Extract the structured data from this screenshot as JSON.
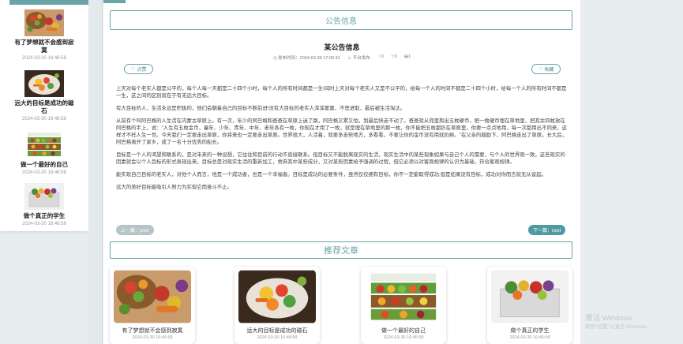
{
  "sidebar": {
    "items": [
      {
        "title": "有了梦想就不会感到寂寞",
        "time": "2024-03-30 16:46:58",
        "icon": "vegetable-basket-image"
      },
      {
        "title": "远大的目标是成功的磁石",
        "time": "2024-03-30 16:46:58",
        "icon": "vegetable-bowl-image"
      },
      {
        "title": "做一个最好的自己",
        "time": "2024-03-30 16:46:58",
        "icon": "produce-market-image"
      },
      {
        "title": "做个真正的学生",
        "time": "2024-03-30 16:46:58",
        "icon": "fruit-box-image"
      }
    ]
  },
  "notice": {
    "section_title": "公告信息",
    "title": "某公告信息",
    "meta": {
      "publish_time": "发布时间：2024-03-30 17:00:31",
      "publisher": "平台发布",
      "likes": "0",
      "favorites": "0",
      "views": "1"
    },
    "like_label": "点赞",
    "collect_label": "收藏",
    "paragraphs": [
      "上天对每个老实人都是公平的，每个人每一天都是二十四个小时，每个人的所有时间都是一生!间时上天对每个老实人又是不公平的，给每一个人的时间不都是二十四个小时，给每一个人的所有时间不都是一生，这之间的区别就在于有无远大目标。",
      "有大目标的人，生活永远是积极的，他们会朝着自己的目标不断前进!没有大目标的老实人浑浑噩噩，不思进取，最后被生活淘汰。",
      "从前有个叫阿巴格的人生活在内蒙古草原上。有一次，年少的阿巴格和爸爸在草原上迷了路，阿巴格又累又怕，到最后快走不动了。爸爸就从兜里掏出五枚硬币，把一枚硬币埋在草地里，把其余四枚放在阿巴格的手上，说：\"人生有五枚金币，童年、少年、青年、中年、老年各有一枚，你现在才用了一枚，就是埋在草地里的那一枚，你不能把五枚都扔在草原里，你要一点点地用，每一次都用出不同来，这样才不枉人生一世。今天我们一定要走出草原，你将来也一定要走出草原。世界很大，人活着，就要多走些地方，多看看，不要让你的金币没有用就扔掉。\"在父亲的鼓励下，阿巴格走出了草原。长大后，阿巴格离开了家乡，成了一名十分优秀的船长。",
      "目标是一个人的渴望和联系的，是对未来的一种设想，它往往和目前的行动不直接联系。但目标又不能脱离现实的生活，现实生活中的某些现象如果与自己个人的需要，与个人的世界观一致，这些现实的因素就会以个人目标的形式表现出来。目标总是对现实生活的重新加工，舍弃其中某些成分，又对某些因素给予强调的过程，但它必须以对客观规律的认识为基础，符合客观规律。",
      "能实现自己目标的老实人，对他个人而言，他是一个成功者，也是一个幸福者。目标是成功的必要条件，虽然仅仅拥有目标，你不一定能取得成功;但是如果没有目标，成功对你而言就无从谈起。",
      "远大的美好目标能吸引人努力为实现它而奋斗不止。"
    ],
    "prev_label": "上一篇：prev",
    "next_label": "下一篇：next"
  },
  "recommend": {
    "section_title": "推荐文章",
    "cards": [
      {
        "title": "有了梦想就不会感到寂寞",
        "time": "2024-03-30 16:46:58",
        "icon": "vegetable-basket-image"
      },
      {
        "title": "远大的目标是成功的磁石",
        "time": "2024-03-30 16:46:58",
        "icon": "vegetable-bowl-image"
      },
      {
        "title": "做一个最好的自己",
        "time": "2024-03-30 16:46:58",
        "icon": "produce-market-image"
      },
      {
        "title": "做个真正的学生",
        "time": "2024-03-30 16:46:58",
        "icon": "fruit-box-image"
      }
    ]
  },
  "watermark": {
    "line1": "激活 Windows",
    "line2": "转到\"设置\"以激活 Windows。"
  },
  "colors": {
    "accent": "#6aa3a8",
    "next_button": "#4f9aa1",
    "prev_button": "#b6c4c8"
  }
}
